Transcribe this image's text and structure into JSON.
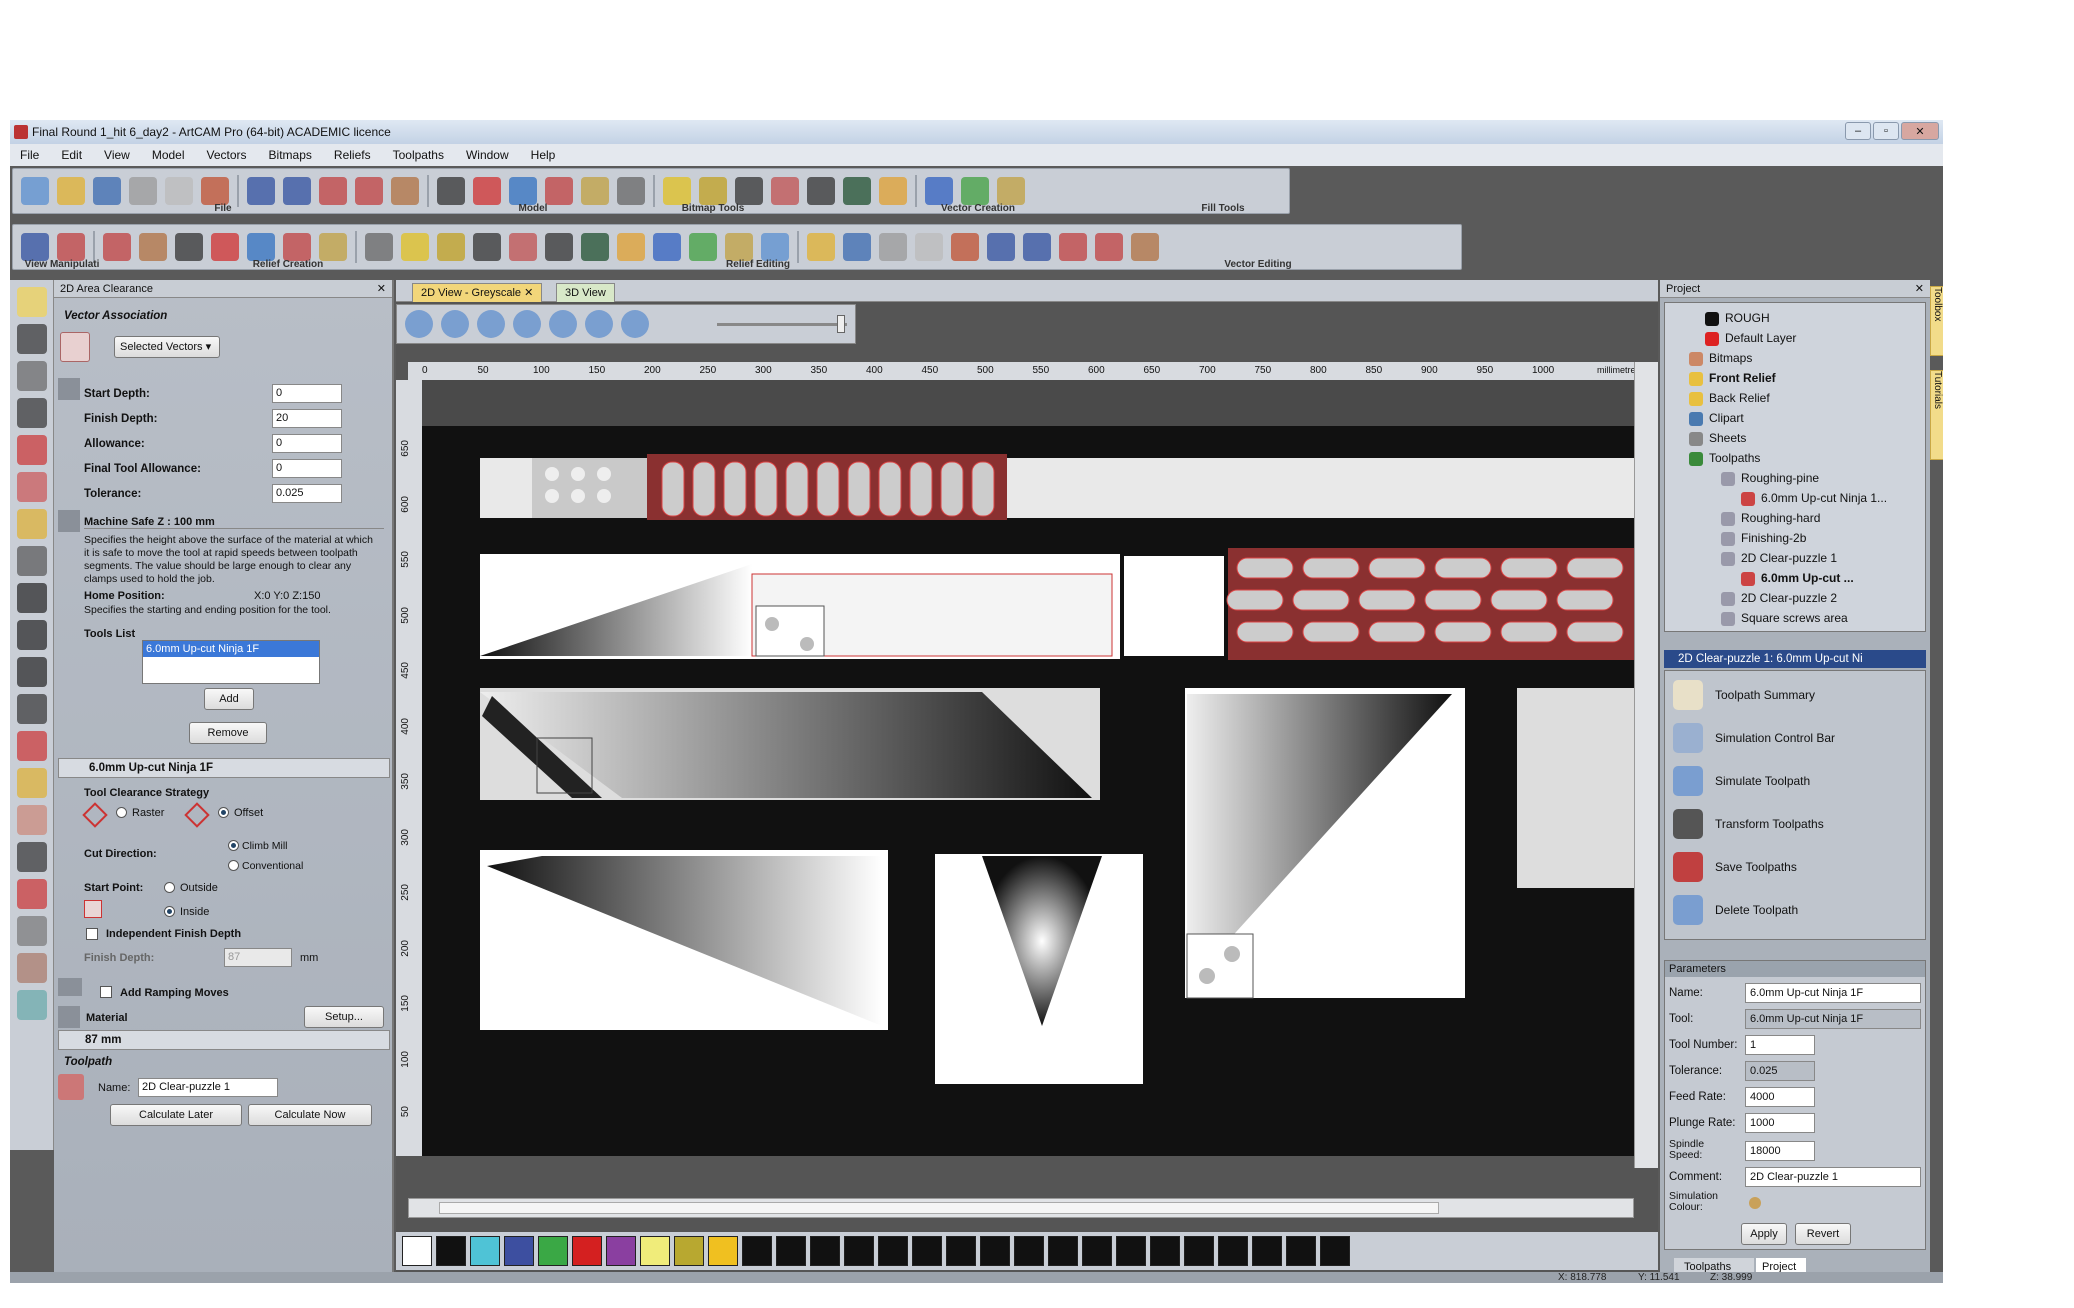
{
  "window": {
    "title": "Final Round 1_hit 6_day2 - ArtCAM Pro (64-bit) ACADEMIC licence"
  },
  "menu": [
    "File",
    "Edit",
    "View",
    "Model",
    "Vectors",
    "Bitmaps",
    "Reliefs",
    "Toolpaths",
    "Window",
    "Help"
  ],
  "toolbar_groups": {
    "file": "File",
    "model": "Model",
    "bitmap_tools": "Bitmap Tools",
    "vector_creation": "Vector Creation",
    "fill_tools": "Fill Tools",
    "view_manip": "View Manipulati",
    "relief_creation": "Relief Creation",
    "relief_editing": "Relief Editing",
    "vector_editing": "Vector Editing"
  },
  "left_panel": {
    "title": "2D Area Clearance",
    "vector_assoc": "Vector Association",
    "selected_vectors": "Selected Vectors",
    "start_depth_label": "Start Depth:",
    "start_depth": "0",
    "finish_depth_label": "Finish Depth:",
    "finish_depth": "20",
    "allowance_label": "Allowance:",
    "allowance": "0",
    "final_allow_label": "Final Tool Allowance:",
    "final_allow": "0",
    "tolerance_label": "Tolerance:",
    "tolerance": "0.025",
    "safe_z": "Machine Safe Z : 100 mm",
    "safe_z_desc": "Specifies the height above the surface of the material at which it is safe to move the tool at rapid speeds between toolpath segments. The value should be large enough to clear any clamps used to hold the job.",
    "home_label": "Home Position:",
    "home_value": "X:0 Y:0 Z:150",
    "home_desc": "Specifies the starting and ending position for the tool.",
    "tools_list": "Tools List",
    "tool_item": "6.0mm Up-cut Ninja 1F",
    "add": "Add",
    "remove": "Remove",
    "tool_dd": "6.0mm Up-cut Ninja 1F",
    "strategy": "Tool Clearance Strategy",
    "raster": "Raster",
    "offset": "Offset",
    "cut_dir": "Cut Direction:",
    "climb": "Climb Mill",
    "conventional": "Conventional",
    "start_point": "Start Point:",
    "outside": "Outside",
    "inside": "Inside",
    "indep": "Independent Finish Depth",
    "finish_depth2_label": "Finish Depth:",
    "finish_depth2": "87",
    "mm": "mm",
    "ramping": "Add Ramping Moves",
    "material": "Material",
    "setup": "Setup...",
    "material_val": "87 mm",
    "toolpath": "Toolpath",
    "name_label": "Name:",
    "name": "2D Clear-puzzle 1",
    "calc_later": "Calculate Later",
    "calc_now": "Calculate Now"
  },
  "view": {
    "tab1": "2D View - Greyscale",
    "tab2": "3D View",
    "units": "millimetres",
    "hticks": [
      "0",
      "50",
      "100",
      "150",
      "200",
      "250",
      "300",
      "350",
      "400",
      "450",
      "500",
      "550",
      "600",
      "650",
      "700",
      "750",
      "800",
      "850",
      "900",
      "950",
      "1000"
    ],
    "vticks": [
      "650",
      "600",
      "550",
      "500",
      "450",
      "400",
      "350",
      "300",
      "250",
      "200",
      "150",
      "100",
      "50"
    ]
  },
  "palette": [
    "#ffffff",
    "#111111",
    "#4fc3d6",
    "#3d4fa0",
    "#3aa845",
    "#d42020",
    "#8a3fa0",
    "#f0ec7a",
    "#b8a830",
    "#f0c020",
    "#111111",
    "#111111",
    "#111111",
    "#111111",
    "#111111",
    "#111111",
    "#111111",
    "#111111",
    "#111111",
    "#111111",
    "#111111",
    "#111111",
    "#111111",
    "#111111",
    "#111111",
    "#111111",
    "#111111",
    "#111111"
  ],
  "project": {
    "title": "Project",
    "tree": [
      {
        "label": "ROUGH",
        "indent": 40,
        "bold": false,
        "icon": "#111"
      },
      {
        "label": "Default Layer",
        "indent": 40,
        "bold": false,
        "icon": "#d22"
      },
      {
        "label": "Bitmaps",
        "indent": 24,
        "bold": false,
        "icon": "#c86"
      },
      {
        "label": "Front Relief",
        "indent": 24,
        "bold": true,
        "icon": "#e8c040"
      },
      {
        "label": "Back Relief",
        "indent": 24,
        "bold": false,
        "icon": "#e8c040"
      },
      {
        "label": "Clipart",
        "indent": 24,
        "bold": false,
        "icon": "#4a7ab0"
      },
      {
        "label": "Sheets",
        "indent": 24,
        "bold": false,
        "icon": "#888"
      },
      {
        "label": "Toolpaths",
        "indent": 24,
        "bold": false,
        "icon": "#3a8a3a"
      },
      {
        "label": "Roughing-pine",
        "indent": 56,
        "bold": false,
        "icon": "#99a"
      },
      {
        "label": "6.0mm Up-cut Ninja 1...",
        "indent": 76,
        "bold": false,
        "icon": "#c44"
      },
      {
        "label": "Roughing-hard",
        "indent": 56,
        "bold": false,
        "icon": "#99a"
      },
      {
        "label": "Finishing-2b",
        "indent": 56,
        "bold": false,
        "icon": "#99a"
      },
      {
        "label": "2D Clear-puzzle 1",
        "indent": 56,
        "bold": false,
        "icon": "#99a"
      },
      {
        "label": "6.0mm Up-cut ...",
        "indent": 76,
        "bold": true,
        "icon": "#c44"
      },
      {
        "label": "2D Clear-puzzle 2",
        "indent": 56,
        "bold": false,
        "icon": "#99a"
      },
      {
        "label": "Square screws area",
        "indent": 56,
        "bold": false,
        "icon": "#99a"
      }
    ],
    "sel_header": "2D Clear-puzzle 1: 6.0mm Up-cut Ni",
    "actions": [
      "Toolpath Summary",
      "Simulation Control Bar",
      "Simulate Toolpath",
      "Transform Toolpaths",
      "Save Toolpaths",
      "Delete Toolpath"
    ],
    "params_title": "Parameters",
    "p_name_l": "Name:",
    "p_name": "6.0mm Up-cut Ninja 1F",
    "p_tool_l": "Tool:",
    "p_tool": "6.0mm Up-cut Ninja 1F",
    "p_num_l": "Tool Number:",
    "p_num": "1",
    "p_tol_l": "Tolerance:",
    "p_tol": "0.025",
    "p_feed_l": "Feed Rate:",
    "p_feed": "4000",
    "p_plunge_l": "Plunge Rate:",
    "p_plunge": "1000",
    "p_spindle_l1": "Spindle",
    "p_spindle_l2": "Speed:",
    "p_spindle": "18000",
    "p_comment_l": "Comment:",
    "p_comment": "2D Clear-puzzle 1",
    "p_simcol_l1": "Simulation",
    "p_simcol_l2": "Colour:",
    "apply": "Apply",
    "revert": "Revert",
    "tab_toolpaths": "Toolpaths",
    "tab_project": "Project"
  },
  "side_tabs": {
    "toolbox": "Toolbox",
    "tutorials": "Tutorials"
  },
  "status": {
    "x": "X: 818.778",
    "y": "Y: 11.541",
    "z": "Z: 38.999"
  }
}
